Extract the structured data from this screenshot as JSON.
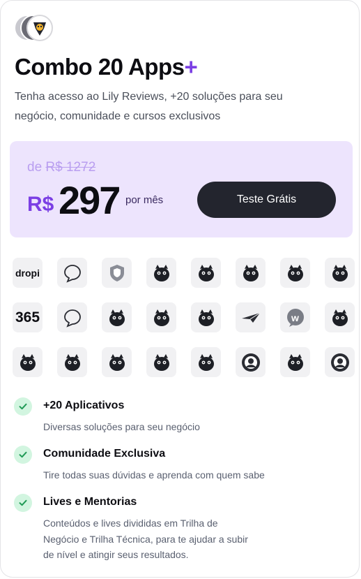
{
  "header": {
    "logos": [
      "avatar-gray",
      "avatar-dark",
      "giraffe-logo"
    ],
    "title": "Combo 20 Apps",
    "title_plus": "+",
    "subtitle": "Tenha acesso ao Lily Reviews, +20 soluções para seu negócio, comunidade e cursos exclusivos"
  },
  "pricing": {
    "old_prefix": "de",
    "old_price": "R$ 1272",
    "currency": "R$",
    "amount": "297",
    "period": "por mês",
    "cta_label": "Teste Grátis",
    "accent_color": "#7b3fe4",
    "box_color": "#ede4fd"
  },
  "apps": [
    {
      "name": "dropi-app",
      "text": "dropi"
    },
    {
      "name": "bird-chat-app",
      "text": ""
    },
    {
      "name": "shield-app",
      "text": ""
    },
    {
      "name": "giraffe-app",
      "text": ""
    },
    {
      "name": "cow-app",
      "text": ""
    },
    {
      "name": "owl-app",
      "text": ""
    },
    {
      "name": "chameleon-app",
      "text": ""
    },
    {
      "name": "ant-app",
      "text": ""
    },
    {
      "name": "365-app",
      "text": "365"
    },
    {
      "name": "fish-chat-app",
      "text": ""
    },
    {
      "name": "panda-app",
      "text": ""
    },
    {
      "name": "blackbird-app",
      "text": ""
    },
    {
      "name": "cat-box-app",
      "text": ""
    },
    {
      "name": "paper-plane-app",
      "text": ""
    },
    {
      "name": "w-chat-app",
      "text": "w"
    },
    {
      "name": "raccoon-app",
      "text": ""
    },
    {
      "name": "robot-dog-app",
      "text": ""
    },
    {
      "name": "bear-app",
      "text": ""
    },
    {
      "name": "wolf-app",
      "text": ""
    },
    {
      "name": "umbrella-app",
      "text": ""
    },
    {
      "name": "parrot-app",
      "text": ""
    },
    {
      "name": "pie-app",
      "text": ""
    },
    {
      "name": "fox-app",
      "text": ""
    },
    {
      "name": "person-app",
      "text": ""
    }
  ],
  "features": [
    {
      "title": "+20 Aplicativos",
      "desc": "Diversas soluções para seu negócio"
    },
    {
      "title": "Comunidade Exclusiva",
      "desc": "Tire todas suas dúvidas e aprenda com quem sabe"
    },
    {
      "title": "Lives e Mentorias",
      "desc": "Conteúdos e lives divididas em Trilha de Negócio e Trilha Técnica, para te ajudar a subir de nível e atingir seus resultados."
    }
  ]
}
